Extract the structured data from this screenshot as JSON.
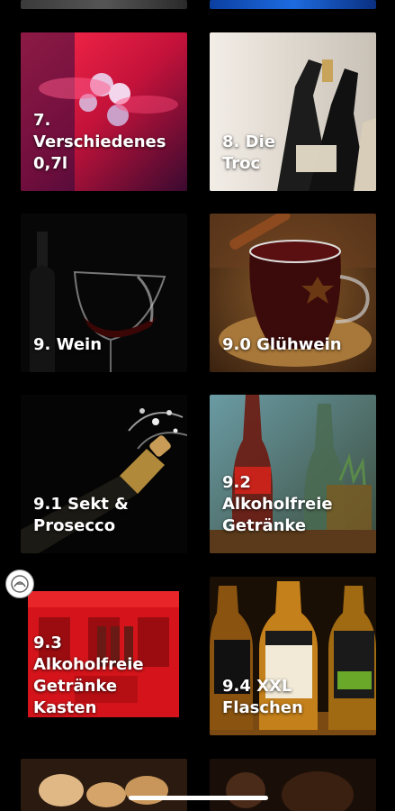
{
  "categories": [
    {
      "label": "7.\nVerschiedenes\n0,7l",
      "icon": "party-drinks-image"
    },
    {
      "label": "8. Die\nTroc",
      "icon": "champagne-bottles-image"
    },
    {
      "label": "9. Wein",
      "icon": "wine-glass-image"
    },
    {
      "label": "9.0 Glühwein",
      "icon": "mulled-wine-image"
    },
    {
      "label": "9.1 Sekt &\nProsecco",
      "icon": "sparkling-wine-image"
    },
    {
      "label": "9.2\nAlkoholfreie\nGetränke",
      "icon": "cola-bottle-image"
    },
    {
      "label": "9.3\nAlkoholfreie\nGetränke\nKasten",
      "icon": "cola-crate-image"
    },
    {
      "label": "9.4 XXL\nFlaschen",
      "icon": "jim-beam-bottles-image"
    }
  ],
  "colors": {
    "background": "#000000",
    "label": "#ffffff"
  }
}
